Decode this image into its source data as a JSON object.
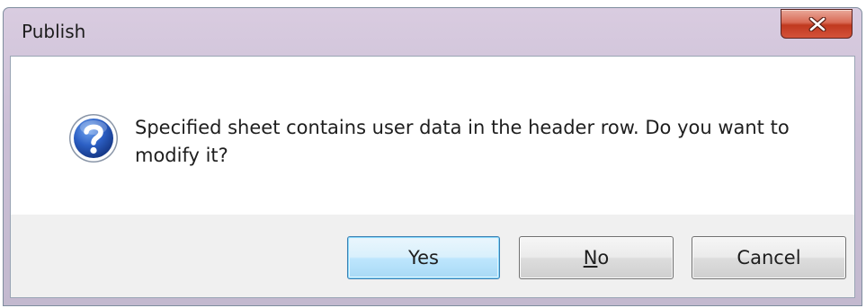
{
  "window": {
    "title": "Publish"
  },
  "icons": {
    "close": "close-icon",
    "message": "question-icon"
  },
  "dialog": {
    "message": "Specified sheet contains user data in the header row. Do you want to modify it?"
  },
  "buttons": {
    "yes_label": "Yes",
    "no_mnemonic": "N",
    "no_rest": "o",
    "cancel_label": "Cancel"
  },
  "colors": {
    "title_bar": "#cbbfd6",
    "close_button": "#c0391f",
    "default_button_border": "#3c7fb1",
    "button_area": "#f0f0f0",
    "question_icon": "#1f4fa8"
  }
}
